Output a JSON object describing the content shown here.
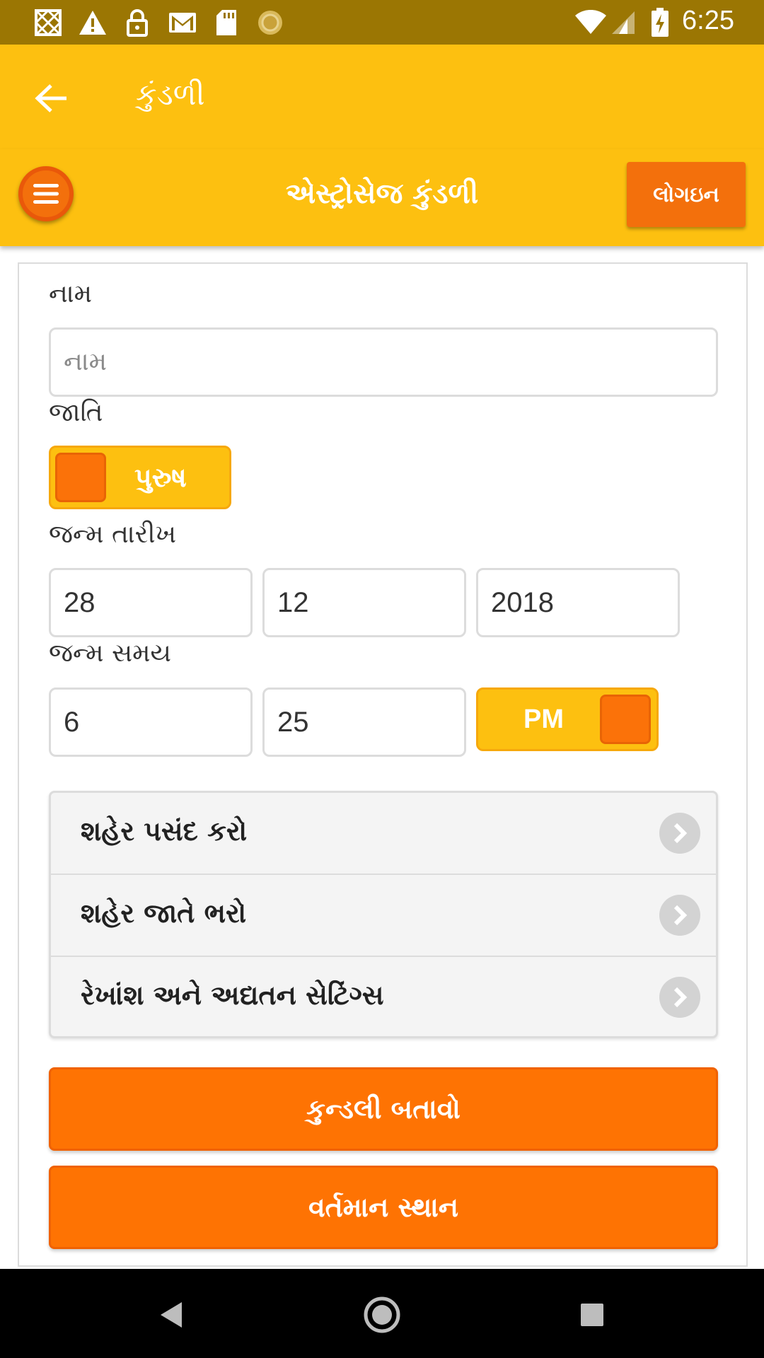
{
  "status_bar": {
    "time": "6:25",
    "icons": [
      "sim-blocked-icon",
      "warning-icon",
      "lock-icon",
      "gmail-icon",
      "sd-card-icon",
      "sun-app-icon",
      "wifi-icon",
      "signal-icon",
      "battery-charging-icon"
    ]
  },
  "app_bar": {
    "title": "કુંડળી",
    "back_icon": "arrow-back-icon"
  },
  "header": {
    "title": "એસ્ટ્રોસેજ કુંડળી",
    "login_label": "લોગઇન",
    "menu_icon": "hamburger-menu-icon"
  },
  "form": {
    "name_label": "નામ",
    "name_placeholder": "નામ",
    "gender_label": "જાતિ",
    "gender_value": "પુરુષ",
    "birth_date_label": "જન્મ તારીખ",
    "birth_day": "28",
    "birth_month": "12",
    "birth_year": "2018",
    "birth_time_label": "જન્મ સમય",
    "birth_hour": "6",
    "birth_minute": "25",
    "ampm_value": "PM"
  },
  "options": [
    {
      "label": "શહેર પસંદ કરો"
    },
    {
      "label": "શહેર જાતે ભરો"
    },
    {
      "label": "રેખાંશ અને અદ્યતન સેટિંગ્સ"
    }
  ],
  "actions": {
    "show_kundli": "કુન્ડલી બતાવો",
    "current_location": "વર્તમાન સ્થાન"
  },
  "colors": {
    "status_bar": "#9b7603",
    "primary": "#fdc010",
    "accent": "#fe7303"
  }
}
